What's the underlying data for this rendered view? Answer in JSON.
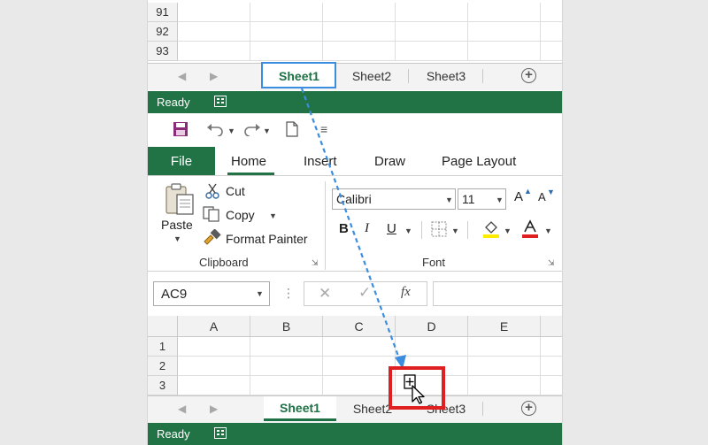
{
  "top": {
    "rows": [
      "91",
      "92",
      "93"
    ],
    "tabs": [
      "Sheet1",
      "Sheet2",
      "Sheet3"
    ],
    "status": "Ready"
  },
  "qat": {
    "more": "≡"
  },
  "ribbon": {
    "tabs": [
      "File",
      "Home",
      "Insert",
      "Draw",
      "Page Layout"
    ],
    "clipboard": {
      "paste": "Paste",
      "cut": "Cut",
      "copy": "Copy",
      "format_painter": "Format Painter",
      "label": "Clipboard"
    },
    "font": {
      "name": "Calibri",
      "size": "11",
      "grow": "A",
      "shrink": "A",
      "bold": "B",
      "italic": "I",
      "underline": "U",
      "label": "Font"
    }
  },
  "formula": {
    "name_box": "AC9",
    "fx": "fx",
    "colon": "⋮"
  },
  "grid": {
    "columns": [
      "A",
      "B",
      "C",
      "D",
      "E"
    ],
    "rows": [
      "1",
      "2",
      "3"
    ]
  },
  "bottom": {
    "tabs": [
      "Sheet1",
      "Sheet2",
      "Sheet3"
    ],
    "status": "Ready"
  },
  "colors": {
    "excel_green": "#217346",
    "highlight_blue": "#3b8de0",
    "highlight_red": "#e02020"
  },
  "icons": [
    "save-icon",
    "undo-icon",
    "redo-icon",
    "new-document-icon",
    "scissors-icon",
    "copy-icon",
    "paintbrush-icon",
    "borders-icon",
    "fill-color-icon",
    "font-color-icon",
    "cancel-icon",
    "enter-icon",
    "add-sheet-icon",
    "copy-cursor-icon"
  ]
}
